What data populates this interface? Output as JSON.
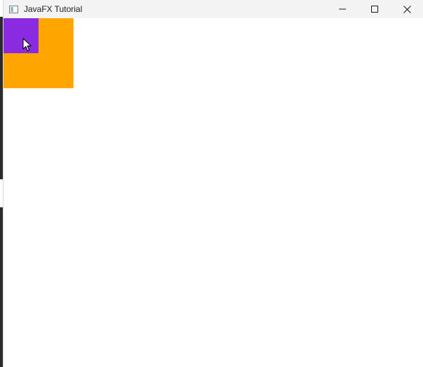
{
  "window": {
    "title": "JavaFX Tutorial",
    "app_icon": "window-app-icon",
    "controls": {
      "minimize_icon": "minimize-icon",
      "maximize_icon": "maximize-icon",
      "close_icon": "close-icon"
    }
  },
  "scene": {
    "background_color": "#ffffff",
    "shapes": [
      {
        "name": "orange-square",
        "color": "#ffa500"
      },
      {
        "name": "purple-square",
        "color": "#8a2be2"
      }
    ]
  },
  "cursor": {
    "icon": "mouse-pointer-icon"
  }
}
